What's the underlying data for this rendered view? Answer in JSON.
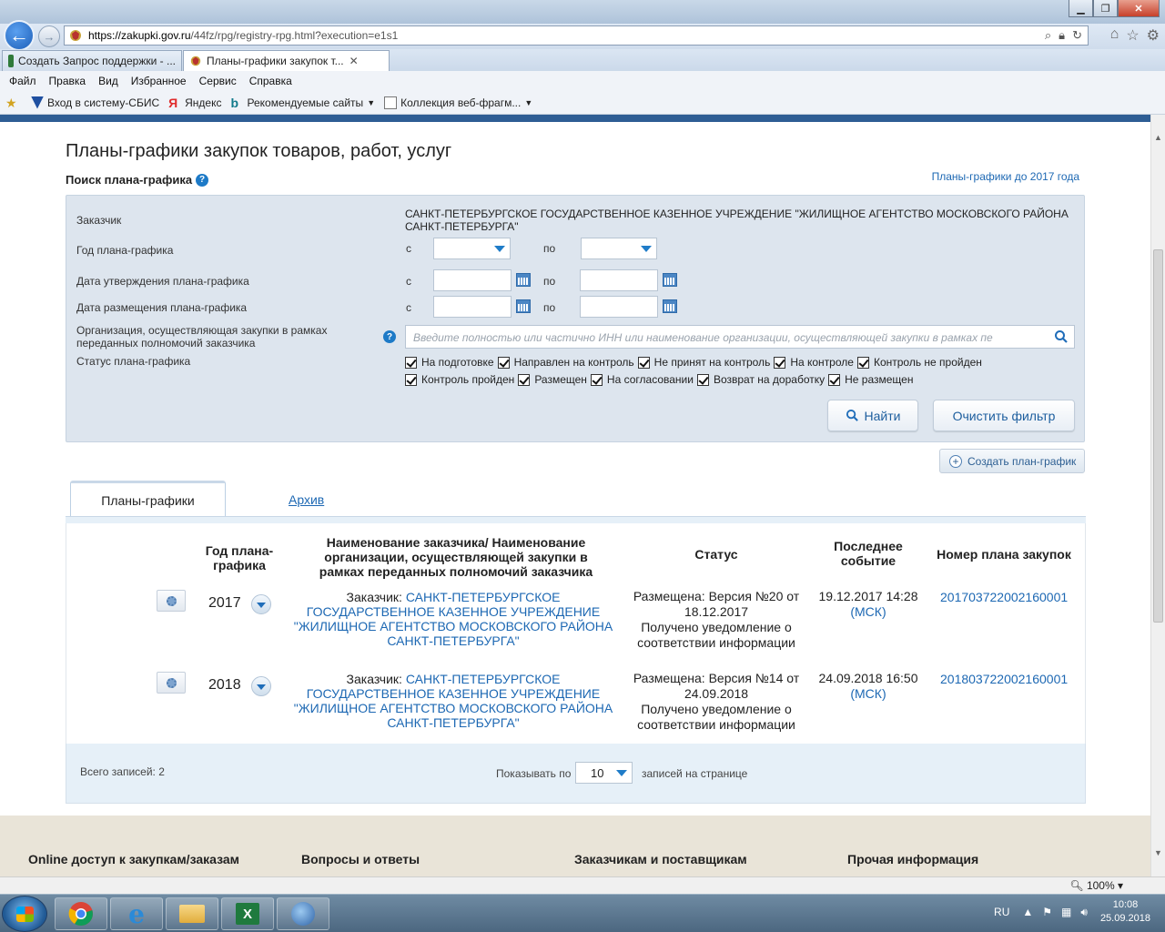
{
  "browser": {
    "url_host": "https://zakupki.gov.ru",
    "url_path": "/44fz/rpg/registry-rpg.html?execution=e1s1",
    "tabs": [
      {
        "label": "Создать Запрос поддержки - ..."
      },
      {
        "label": "Планы-графики закупок т..."
      }
    ],
    "menu": [
      "Файл",
      "Правка",
      "Вид",
      "Избранное",
      "Сервис",
      "Справка"
    ],
    "favorites": [
      "Вход в систему-СБИС",
      "Яндекс",
      "Рекомендуемые сайты",
      "Коллекция веб-фрагм..."
    ],
    "zoom": "100%"
  },
  "page": {
    "title": "Планы-графики закупок товаров, работ, услуг",
    "search_title": "Поиск плана-графика",
    "old_plans_link": "Планы-графики до 2017 года"
  },
  "filter": {
    "customer_label": "Заказчик",
    "customer_value": "САНКТ-ПЕТЕРБУРГСКОЕ ГОСУДАРСТВЕННОЕ КАЗЕННОЕ УЧРЕЖДЕНИЕ \"ЖИЛИЩНОЕ АГЕНТСТВО МОСКОВСКОГО РАЙОНА САНКТ-ПЕТЕРБУРГА\"",
    "year_label": "Год плана-графика",
    "approve_label": "Дата утверждения плана-графика",
    "publish_label": "Дата размещения плана-графика",
    "org_label": "Организация, осуществляющая закупки в рамках переданных полномочий заказчика",
    "status_label": "Статус плана-графика",
    "from": "с",
    "to": "по",
    "org_placeholder": "Введите полностью или частично ИНН или наименование организации, осуществляющей закупки в рамках пе",
    "statuses_row1": [
      "На подготовке",
      "Направлен на контроль",
      "Не принят на контроль",
      "На контроле",
      "Контроль не пройден"
    ],
    "statuses_row2": [
      "Контроль пройден",
      "Размещен",
      "На согласовании",
      "Возврат на доработку",
      "Не размещен"
    ],
    "find_button": "Найти",
    "clear_button": "Очистить фильтр"
  },
  "create_button": "Создать план-график",
  "tabs": {
    "main": "Планы-графики",
    "archive": "Архив"
  },
  "table": {
    "headers": {
      "year": "Год плана-графика",
      "name": "Наименование заказчика/ Наименование организации, осуществляющей закупки в рамках переданных полномочий заказчика",
      "status": "Статус",
      "event": "Последнее событие",
      "number": "Номер плана закупок"
    },
    "rows": [
      {
        "year": "2017",
        "customer_prefix": "Заказчик:",
        "customer_name": "САНКТ-ПЕТЕРБУРГСКОЕ ГОСУДАРСТВЕННОЕ КАЗЕННОЕ УЧРЕЖДЕНИЕ \"ЖИЛИЩНОЕ АГЕНТСТВО МОСКОВСКОГО РАЙОНА САНКТ-ПЕТЕРБУРГА\"",
        "status_version": "Размещена: Версия №20 от 18.12.2017",
        "status_note": "Получено уведомление о соответствии информации",
        "event_date": "19.12.2017 14:28",
        "event_tz": "(МСК)",
        "number": "201703722002160001"
      },
      {
        "year": "2018",
        "customer_prefix": "Заказчик:",
        "customer_name": "САНКТ-ПЕТЕРБУРГСКОЕ ГОСУДАРСТВЕННОЕ КАЗЕННОЕ УЧРЕЖДЕНИЕ \"ЖИЛИЩНОЕ АГЕНТСТВО МОСКОВСКОГО РАЙОНА САНКТ-ПЕТЕРБУРГА\"",
        "status_version": "Размещена: Версия №14 от 24.09.2018",
        "status_note": "Получено уведомление о соответствии информации",
        "event_date": "24.09.2018 16:50",
        "event_tz": "(МСК)",
        "number": "201803722002160001"
      }
    ],
    "total": "Всего записей: 2",
    "show_by": "Показывать по",
    "per_page": "10",
    "per_page_suffix": "записей на странице"
  },
  "footer": [
    "Online доступ к закупкам/заказам",
    "Вопросы и ответы",
    "Заказчикам и поставщикам",
    "Прочая информация"
  ],
  "taskbar": {
    "lang": "RU",
    "time": "10:08",
    "date": "25.09.2018"
  },
  "colors": {
    "link": "#1d68b3",
    "filter_bg": "#dde5ee",
    "header_bar": "#2e5d94"
  }
}
